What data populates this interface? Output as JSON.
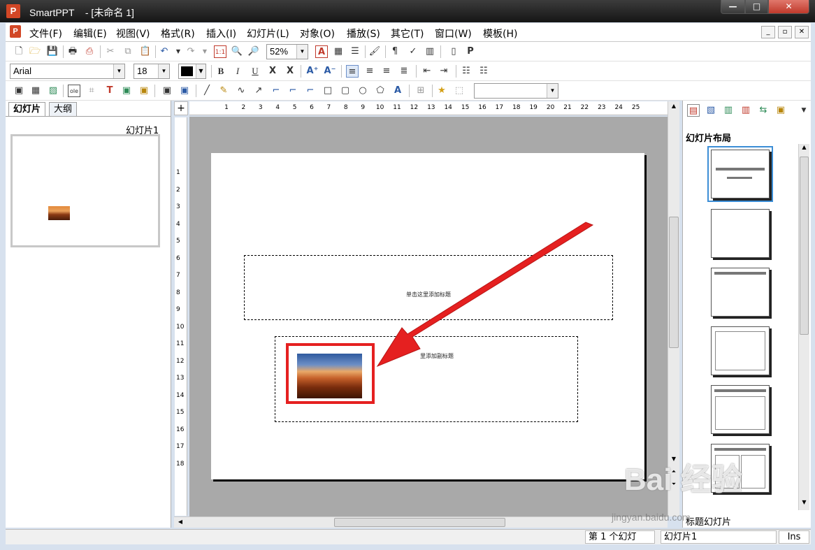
{
  "window": {
    "app_name": "SmartPPT",
    "doc_title": "- [未命名 1]",
    "min_label": "—",
    "max_label": "□",
    "close_label": "✕"
  },
  "menu": {
    "items": [
      "文件(F)",
      "编辑(E)",
      "视图(V)",
      "格式(R)",
      "插入(I)",
      "幻灯片(L)",
      "对象(O)",
      "播放(S)",
      "其它(T)",
      "窗口(W)",
      "模板(H)"
    ]
  },
  "toolbar": {
    "zoom": "52%",
    "font_name": "Arial",
    "font_size": "18",
    "bold": "B",
    "italic": "I",
    "underline": "U"
  },
  "left_panel": {
    "tabs": [
      "幻灯片",
      "大纲"
    ],
    "slide_label": "幻灯片1"
  },
  "ruler": {
    "h_ticks": [
      "1",
      "2",
      "3",
      "4",
      "5",
      "6",
      "7",
      "8",
      "9",
      "10",
      "11",
      "12",
      "13",
      "14",
      "15",
      "16",
      "17",
      "18",
      "19",
      "20",
      "21",
      "22",
      "23",
      "24",
      "25"
    ],
    "v_ticks": [
      "1",
      "2",
      "3",
      "4",
      "5",
      "6",
      "7",
      "8",
      "9",
      "10",
      "11",
      "12",
      "13",
      "14",
      "15",
      "16",
      "17",
      "18"
    ]
  },
  "slide": {
    "title_placeholder": "单击这里添加标题",
    "subtitle_placeholder": "里添加副标题"
  },
  "right_panel": {
    "title": "幻灯片布局",
    "bottom_label": "标题幻灯片"
  },
  "status": {
    "slide_pos": "第 1 个幻灯",
    "slide_name": "幻灯片1",
    "mode": "Ins"
  },
  "colors": {
    "highlight": "#e52020",
    "arrow": "#e52020",
    "selection": "#3c8ed6"
  },
  "watermark": {
    "main": "Bai 经验",
    "sub": "jingyan.baidu.com"
  }
}
